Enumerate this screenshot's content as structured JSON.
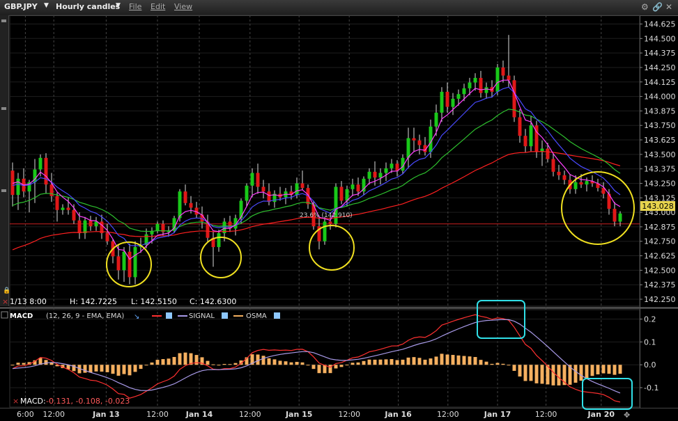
{
  "toolbar": {
    "symbol": "GBP.JPY",
    "interval": "Hourly candles",
    "menu": [
      "File",
      "Edit",
      "View"
    ],
    "icons": [
      "gear-icon",
      "link-icon",
      "close-icon"
    ]
  },
  "price_panel": {
    "ohlc_readout": {
      "date": "1/13 8:00",
      "high": "H: 142.7225",
      "low": "L: 142.5150",
      "close": "C: 142.6300"
    },
    "last_price_label": "143.028",
    "fib_label": "23.6% (142.910)"
  },
  "macd_panel": {
    "title": "MACD",
    "params": "(12, 26, 9 - EMA, EMA)",
    "legend": [
      {
        "name": "",
        "color": "#ff3030"
      },
      {
        "name": "SIGNAL",
        "color": "#a89ae8"
      },
      {
        "name": "OSMA",
        "color": "#f5b060"
      }
    ],
    "readout_label": "MACD:",
    "readout_values": "-0.131, -0.108, -0.023"
  },
  "chart_data": [
    {
      "type": "candlestick",
      "title": "GBP.JPY",
      "ylim": [
        142.19,
        144.7
      ],
      "y_ticks": [
        "144.625",
        "144.500",
        "144.375",
        "144.250",
        "144.125",
        "144.000",
        "143.875",
        "143.750",
        "143.625",
        "143.500",
        "143.375",
        "143.250",
        "143.125",
        "143.000",
        "142.875",
        "142.750",
        "142.625",
        "142.500",
        "142.375",
        "142.250"
      ],
      "x_ticks": [
        "6:00",
        "12:00",
        "Jan 13",
        "12:00",
        "Jan 14",
        "12:00",
        "Jan 15",
        "12:00",
        "Jan 16",
        "12:00",
        "Jan 17",
        "12:00",
        "Jan 20"
      ],
      "candles": [
        [
          143.36,
          143.43,
          143.05,
          143.15
        ],
        [
          143.15,
          143.34,
          143.02,
          143.29
        ],
        [
          143.29,
          143.38,
          143.13,
          143.18
        ],
        [
          143.18,
          143.28,
          143.0,
          143.26
        ],
        [
          143.26,
          143.46,
          143.08,
          143.37
        ],
        [
          143.37,
          143.5,
          143.31,
          143.47
        ],
        [
          143.47,
          143.51,
          143.16,
          143.24
        ],
        [
          143.24,
          143.34,
          143.09,
          143.14
        ],
        [
          143.14,
          143.17,
          142.92,
          143.02
        ],
        [
          143.02,
          143.07,
          142.98,
          143.04
        ],
        [
          143.04,
          143.13,
          142.98,
          143.02
        ],
        [
          143.02,
          143.07,
          142.9,
          142.93
        ],
        [
          142.93,
          143.0,
          142.77,
          142.82
        ],
        [
          142.82,
          142.96,
          142.77,
          142.93
        ],
        [
          142.93,
          142.97,
          142.84,
          142.88
        ],
        [
          142.88,
          142.96,
          142.84,
          142.92
        ],
        [
          142.92,
          142.98,
          142.77,
          142.82
        ],
        [
          142.82,
          142.9,
          142.72,
          142.75
        ],
        [
          142.75,
          142.77,
          142.56,
          142.62
        ],
        [
          142.62,
          142.72,
          142.42,
          142.5
        ],
        [
          142.5,
          142.7,
          142.4,
          142.66
        ],
        [
          142.66,
          142.73,
          142.38,
          142.44
        ],
        [
          142.44,
          142.75,
          142.38,
          142.7
        ],
        [
          142.7,
          142.78,
          142.65,
          142.72
        ],
        [
          142.72,
          142.86,
          142.69,
          142.81
        ],
        [
          142.81,
          142.87,
          142.73,
          142.84
        ],
        [
          142.84,
          142.92,
          142.82,
          142.9
        ],
        [
          142.9,
          142.93,
          142.8,
          142.83
        ],
        [
          142.83,
          142.88,
          142.79,
          142.84
        ],
        [
          142.84,
          142.97,
          142.82,
          142.95
        ],
        [
          142.95,
          143.2,
          142.92,
          143.18
        ],
        [
          143.18,
          143.24,
          143.06,
          143.08
        ],
        [
          143.08,
          143.14,
          142.99,
          143.04
        ],
        [
          143.04,
          143.09,
          142.95,
          142.98
        ],
        [
          142.98,
          143.05,
          142.86,
          142.92
        ],
        [
          142.92,
          142.98,
          142.74,
          142.78
        ],
        [
          142.78,
          142.83,
          142.53,
          142.7
        ],
        [
          142.7,
          142.85,
          142.66,
          142.82
        ],
        [
          142.82,
          142.95,
          142.75,
          142.92
        ],
        [
          142.92,
          142.97,
          142.83,
          142.86
        ],
        [
          142.86,
          142.98,
          142.8,
          142.95
        ],
        [
          142.95,
          143.12,
          142.9,
          143.1
        ],
        [
          143.1,
          143.25,
          143.05,
          143.23
        ],
        [
          143.23,
          143.38,
          143.13,
          143.34
        ],
        [
          143.34,
          143.42,
          143.16,
          143.22
        ],
        [
          143.22,
          143.28,
          143.12,
          143.18
        ],
        [
          143.18,
          143.25,
          143.06,
          143.09
        ],
        [
          143.09,
          143.19,
          143.04,
          143.16
        ],
        [
          143.16,
          143.22,
          143.1,
          143.13
        ],
        [
          143.13,
          143.21,
          143.07,
          143.18
        ],
        [
          143.18,
          143.23,
          143.11,
          143.15
        ],
        [
          143.15,
          143.3,
          143.12,
          143.25
        ],
        [
          143.25,
          143.36,
          143.19,
          143.21
        ],
        [
          143.21,
          143.24,
          143.03,
          143.07
        ],
        [
          143.07,
          143.1,
          142.85,
          142.88
        ],
        [
          142.88,
          142.97,
          142.68,
          142.75
        ],
        [
          142.75,
          142.96,
          142.72,
          142.92
        ],
        [
          142.92,
          142.96,
          142.85,
          142.9
        ],
        [
          142.9,
          143.25,
          142.87,
          143.22
        ],
        [
          143.22,
          143.27,
          143.07,
          143.1
        ],
        [
          143.1,
          143.23,
          143.05,
          143.2
        ],
        [
          143.2,
          143.29,
          143.14,
          143.24
        ],
        [
          143.24,
          143.3,
          143.14,
          143.18
        ],
        [
          143.18,
          143.31,
          143.15,
          143.29
        ],
        [
          143.29,
          143.38,
          143.24,
          143.35
        ],
        [
          143.35,
          143.44,
          143.23,
          143.3
        ],
        [
          143.3,
          143.38,
          143.24,
          143.34
        ],
        [
          143.34,
          143.43,
          143.27,
          143.38
        ],
        [
          143.38,
          143.46,
          143.34,
          143.42
        ],
        [
          143.42,
          143.45,
          143.31,
          143.36
        ],
        [
          143.36,
          143.5,
          143.33,
          143.47
        ],
        [
          143.47,
          143.73,
          143.38,
          143.64
        ],
        [
          143.64,
          143.73,
          143.52,
          143.62
        ],
        [
          143.62,
          143.67,
          143.5,
          143.58
        ],
        [
          143.58,
          143.65,
          143.49,
          143.52
        ],
        [
          143.52,
          143.8,
          143.47,
          143.74
        ],
        [
          143.74,
          143.93,
          143.66,
          143.86
        ],
        [
          143.86,
          144.08,
          143.78,
          144.04
        ],
        [
          144.04,
          144.12,
          143.86,
          143.91
        ],
        [
          143.91,
          144.03,
          143.84,
          143.98
        ],
        [
          143.98,
          144.06,
          143.92,
          144.02
        ],
        [
          144.02,
          144.11,
          143.96,
          144.07
        ],
        [
          144.07,
          144.16,
          144.01,
          144.12
        ],
        [
          144.12,
          144.2,
          144.05,
          144.16
        ],
        [
          144.16,
          144.22,
          143.99,
          144.03
        ],
        [
          144.03,
          144.12,
          143.98,
          144.08
        ],
        [
          144.08,
          144.14,
          143.99,
          144.04
        ],
        [
          144.04,
          144.28,
          144.01,
          144.25
        ],
        [
          144.25,
          144.31,
          144.12,
          144.18
        ],
        [
          144.18,
          144.53,
          144.08,
          144.14
        ],
        [
          144.14,
          144.18,
          143.78,
          143.82
        ],
        [
          143.82,
          143.89,
          143.6,
          143.66
        ],
        [
          143.66,
          143.72,
          143.52,
          143.57
        ],
        [
          143.57,
          143.83,
          143.52,
          143.75
        ],
        [
          143.75,
          143.79,
          143.47,
          143.52
        ],
        [
          143.52,
          143.62,
          143.4,
          143.55
        ],
        [
          143.55,
          143.6,
          143.43,
          143.46
        ],
        [
          143.46,
          143.51,
          143.31,
          143.35
        ],
        [
          143.35,
          143.41,
          143.28,
          143.32
        ],
        [
          143.32,
          143.36,
          143.24,
          143.28
        ],
        [
          143.28,
          143.33,
          143.16,
          143.2
        ],
        [
          143.2,
          143.32,
          143.16,
          143.26
        ],
        [
          143.26,
          143.33,
          143.21,
          143.24
        ],
        [
          143.24,
          143.3,
          143.18,
          143.27
        ],
        [
          143.27,
          143.32,
          143.22,
          143.25
        ],
        [
          143.25,
          143.29,
          143.18,
          143.21
        ],
        [
          143.21,
          143.26,
          143.12,
          143.16
        ],
        [
          143.16,
          143.2,
          142.98,
          143.03
        ],
        [
          143.03,
          143.09,
          142.88,
          142.92
        ],
        [
          142.92,
          143.01,
          142.88,
          142.99
        ]
      ],
      "lines": [
        {
          "name": "",
          "color": "#ff2020",
          "start": 142.68,
          "end": 143.23
        },
        {
          "name": "",
          "color": "#2ec02e",
          "start": 143.0,
          "end": 143.48
        },
        {
          "name": "",
          "color": "#4a4aff",
          "start": 143.2,
          "end": 143.36
        },
        {
          "name": "",
          "color": "#ff40ff",
          "start": 143.28,
          "end": 143.18
        }
      ],
      "horizontal_line": {
        "value": 142.9,
        "color": "#cc2020"
      },
      "annotations": [
        "yellow circles at four lows",
        "cyan boxes on MACD turns"
      ]
    },
    {
      "type": "line",
      "title": "MACD",
      "ylim": [
        -0.185,
        0.235
      ],
      "y_ticks": [
        "0.2",
        "0.1",
        "0.0",
        "-0.1"
      ],
      "series": [
        {
          "name": "MACD",
          "color": "#ff3030"
        },
        {
          "name": "SIGNAL",
          "color": "#a89ae8"
        },
        {
          "name": "OSMA",
          "color": "#f5b060"
        }
      ]
    }
  ]
}
